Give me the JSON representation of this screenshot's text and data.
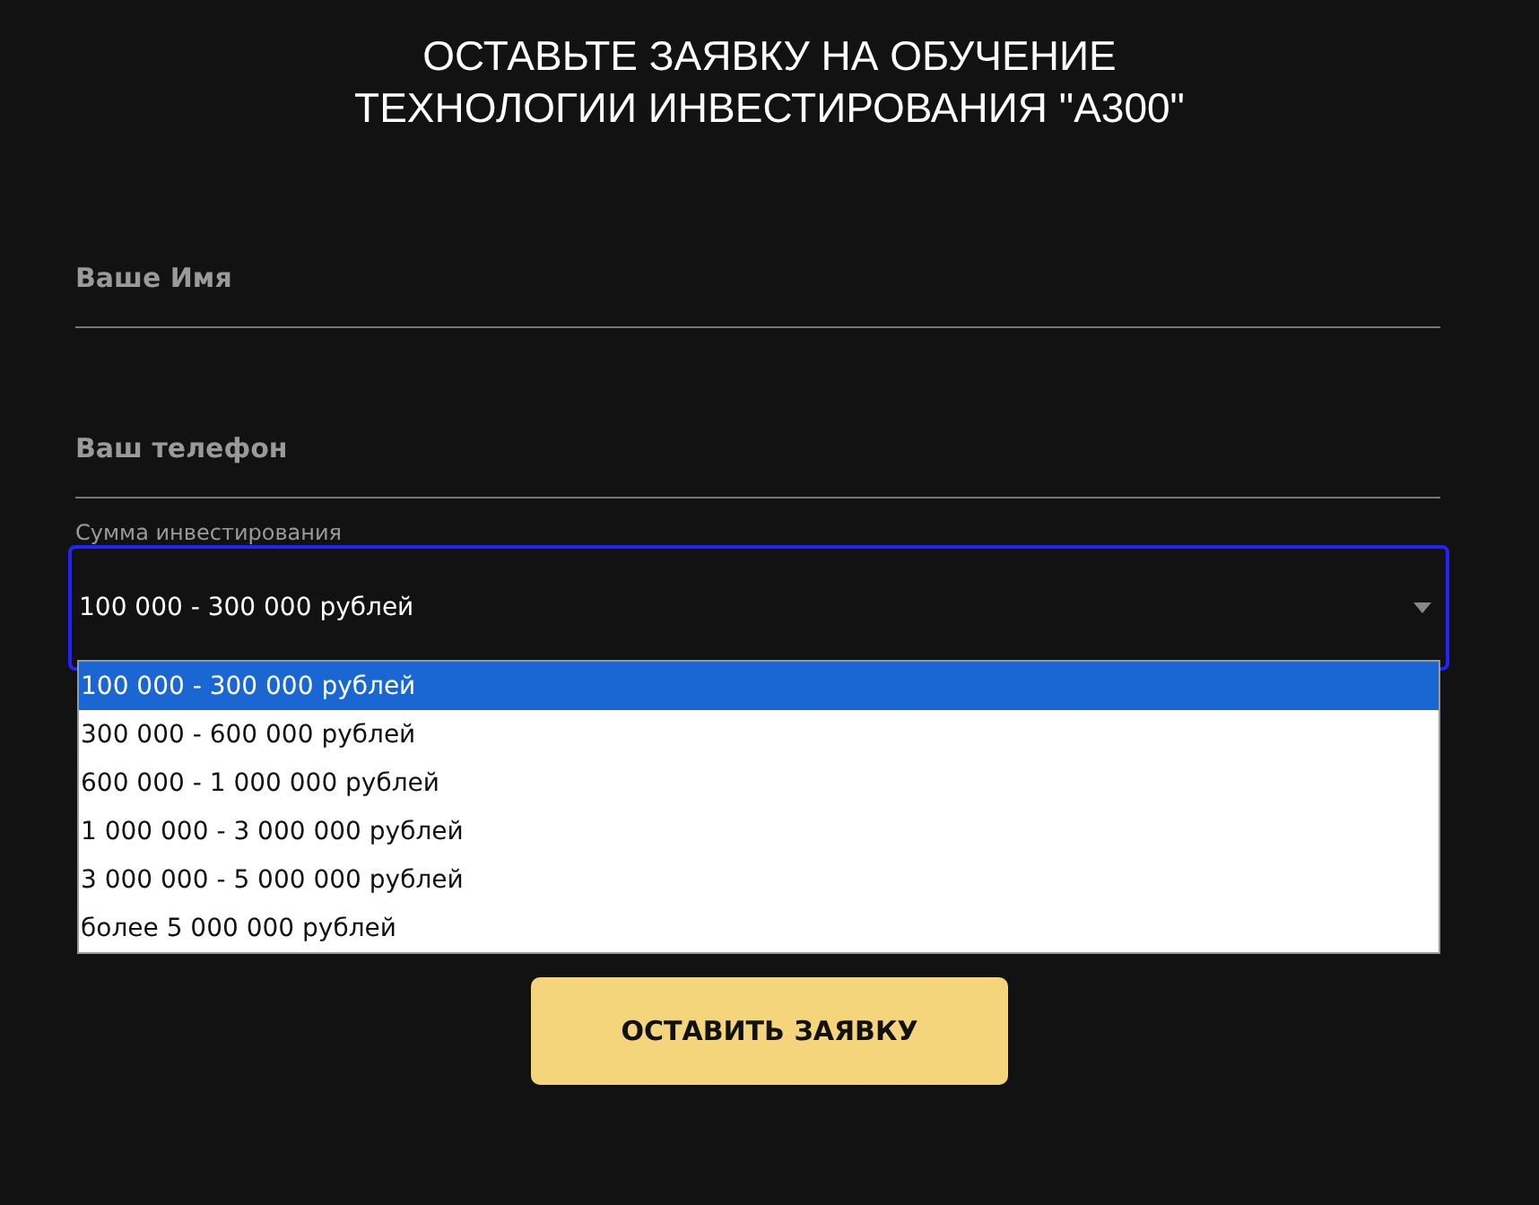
{
  "title_lines": [
    "ОСТАВЬТЕ ЗАЯВКУ НА ОБУЧЕНИЕ",
    "ТЕХНОЛОГИИ ИНВЕСТИРОВАНИЯ \"А300\""
  ],
  "fields": [
    {
      "placeholder": "Ваше Имя"
    },
    {
      "placeholder": "Ваш телефон"
    }
  ],
  "select": {
    "label": "Сумма инвестирования",
    "value": "100 000 - 300 000 рублей",
    "expanded": true,
    "options": [
      {
        "label": "100 000 - 300 000 рублей",
        "selected": true
      },
      {
        "label": "300 000 - 600 000 рублей",
        "selected": false
      },
      {
        "label": "600 000 - 1 000 000 рублей",
        "selected": false
      },
      {
        "label": "1 000 000 - 3 000 000 рублей",
        "selected": false
      },
      {
        "label": "3 000 000 - 5 000 000 рублей",
        "selected": false
      },
      {
        "label": "более 5 000 000 рублей",
        "selected": false
      }
    ]
  },
  "submit_button": "ОСТАВИТЬ ЗАЯВКУ"
}
